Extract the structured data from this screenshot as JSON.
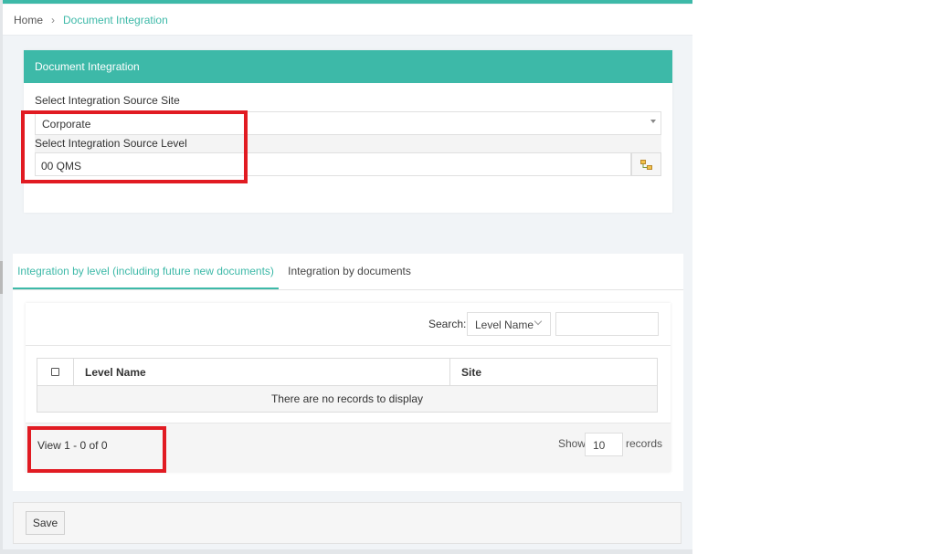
{
  "breadcrumb": {
    "home": "Home",
    "separator": "›",
    "current": "Document Integration"
  },
  "card": {
    "title": "Document Integration",
    "site_label": "Select Integration Source Site",
    "site_value": "Corporate",
    "level_label": "Select Integration Source Level",
    "level_value": "00 QMS",
    "level_button_icon": "tree-icon"
  },
  "tabs": [
    {
      "label": "Integration by level (including future new documents)",
      "active": true
    },
    {
      "label": "Integration by documents",
      "active": false
    }
  ],
  "grid": {
    "search_label": "Search:",
    "search_field": "Level Name",
    "search_value": "",
    "columns": [
      "Level Name",
      "Site"
    ],
    "empty_message": "There are no records to display",
    "pager_info": "View 1 - 0 of 0",
    "show_label": "Show",
    "page_size": "10",
    "records_label": "records"
  },
  "footer": {
    "save_label": "Save"
  },
  "colors": {
    "accent": "#3db9a8",
    "highlight": "#e11b22"
  }
}
